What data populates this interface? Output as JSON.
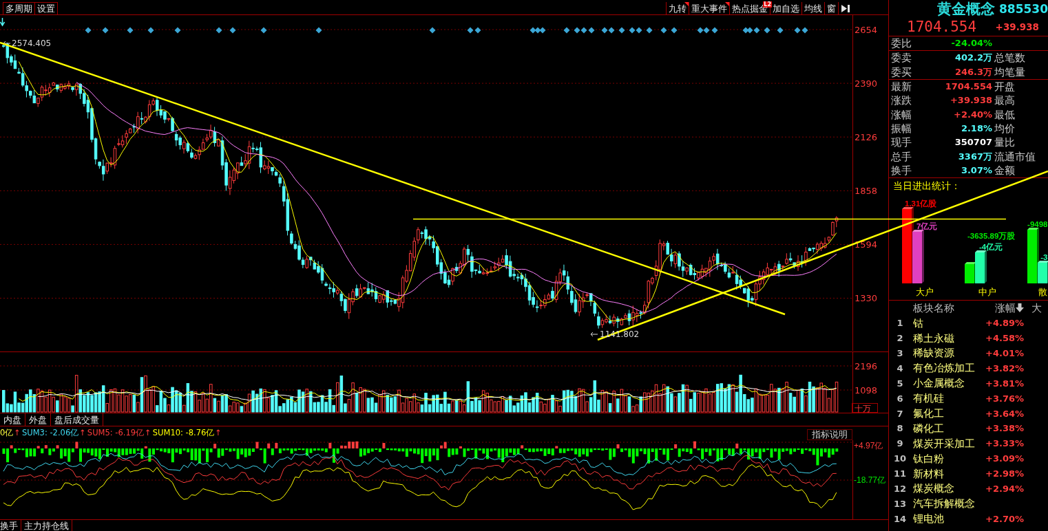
{
  "toolbar": {
    "left_buttons": [
      "多周期",
      "设置"
    ],
    "right_buttons": [
      {
        "label": "九转",
        "flag": true
      },
      {
        "label": "重大事件",
        "flag": true
      },
      {
        "label": "热点掘金",
        "flag": false,
        "badge": "L2"
      },
      {
        "label": "加自选",
        "flag": false
      },
      {
        "label": "均线",
        "flag": false
      },
      {
        "label": "窗",
        "flag": false
      }
    ]
  },
  "main_chart": {
    "axis_labels": [
      "2654",
      "2390",
      "2126",
      "1858",
      "1594",
      "1330"
    ],
    "high_label": "2574.405",
    "low_label": "1141.802"
  },
  "volume_chart": {
    "axis_labels": [
      "2196",
      "1098"
    ],
    "unit": "十万"
  },
  "volume_tabs": [
    "内盘",
    "外盘",
    "盘后成交量"
  ],
  "indicator": {
    "legend": [
      {
        "text": "0亿",
        "arrow": "↑",
        "color": "#ffff40"
      },
      {
        "text": "SUM3: -2.06亿",
        "arrow": "↑",
        "color": "#40d8f0"
      },
      {
        "text": "SUM5: -6.19亿",
        "arrow": "↑",
        "color": "#ff3c3c"
      },
      {
        "text": "SUM10: -8.76亿",
        "arrow": "↑",
        "color": "#ffff00"
      }
    ],
    "help_button": "指标说明",
    "axis_labels": [
      {
        "text": "+4.97亿",
        "color": "#ff3c3c"
      },
      {
        "text": "-18.77亿",
        "color": "#00e600"
      }
    ]
  },
  "bottom_tabs": [
    "换手",
    "主力持仓线"
  ],
  "quote": {
    "name": "黄金概念",
    "code": "885530",
    "price": "1704.554",
    "change": "+39.938"
  },
  "stat_sections": [
    {
      "rows": [
        {
          "label": "委比",
          "value": "-24.04%",
          "color": "#00e600"
        }
      ]
    },
    {
      "rows": [
        {
          "label": "委卖",
          "value": "402.2万",
          "color": "#54fcfc",
          "label_2": "总笔数"
        },
        {
          "label": "委买",
          "value": "246.3万",
          "color": "#ff3c3c",
          "label_2": "均笔量"
        }
      ]
    },
    {
      "rows": [
        {
          "label": "最新",
          "value": "1704.554",
          "color": "#ff3c3c",
          "label_2": "开盘"
        },
        {
          "label": "涨跌",
          "value": "+39.938",
          "color": "#ff3c3c",
          "label_2": "最高"
        },
        {
          "label": "涨幅",
          "value": "+2.40%",
          "color": "#ff3c3c",
          "label_2": "最低"
        },
        {
          "label": "振幅",
          "value": "2.18%",
          "color": "#54fcfc",
          "label_2": "均价"
        },
        {
          "label": "现手",
          "value": "350707",
          "color": "#ffffff",
          "label_2": "量比"
        },
        {
          "label": "总手",
          "value": "3367万",
          "color": "#54fcfc",
          "label_2": "流通市值"
        },
        {
          "label": "换手",
          "value": "3.07%",
          "color": "#54fcfc",
          "label_2": "金额"
        }
      ]
    }
  ],
  "flow_stats": {
    "title": "当日进出统计：",
    "groups": [
      {
        "label": "大户",
        "bars": [
          {
            "reading": "1.31亿股",
            "color": "#ff0000"
          },
          {
            "reading": "7亿元",
            "color": "#e040c0"
          }
        ]
      },
      {
        "label": "中户",
        "bars": [
          {
            "reading": "-3635.89万股",
            "color": "#00ee00"
          },
          {
            "reading": "-4亿元",
            "color": "#22ffaa"
          }
        ]
      },
      {
        "label": "散",
        "bars": [
          {
            "reading": "-9498",
            "color": "#00ee00"
          },
          {
            "reading": "-3",
            "color": "#22ffaa"
          }
        ]
      }
    ]
  },
  "sector_table": {
    "columns": [
      {
        "label": "板块名称",
        "sorted": false
      },
      {
        "label": "涨幅",
        "sorted": true
      },
      {
        "label": "大",
        "sorted": false
      }
    ],
    "rows": [
      {
        "rank": "1",
        "name": "钴",
        "change": "+4.89%"
      },
      {
        "rank": "2",
        "name": "稀土永磁",
        "change": "+4.58%"
      },
      {
        "rank": "3",
        "name": "稀缺资源",
        "change": "+4.01%"
      },
      {
        "rank": "4",
        "name": "有色冶炼加工",
        "change": "+3.82%"
      },
      {
        "rank": "5",
        "name": "小金属概念",
        "change": "+3.81%"
      },
      {
        "rank": "6",
        "name": "有机硅",
        "change": "+3.76%"
      },
      {
        "rank": "7",
        "name": "氟化工",
        "change": "+3.64%"
      },
      {
        "rank": "8",
        "name": "磷化工",
        "change": "+3.38%"
      },
      {
        "rank": "9",
        "name": "煤炭开采加工",
        "change": "+3.33%"
      },
      {
        "rank": "10",
        "name": "钛白粉",
        "change": "+3.09%"
      },
      {
        "rank": "11",
        "name": "新材料",
        "change": "+2.98%"
      },
      {
        "rank": "12",
        "name": "煤炭概念",
        "change": "+2.94%"
      },
      {
        "rank": "13",
        "name": "汽车拆解概念"
      },
      {
        "rank": "14",
        "name": "锂电池",
        "change": "+2.70%"
      }
    ]
  }
}
